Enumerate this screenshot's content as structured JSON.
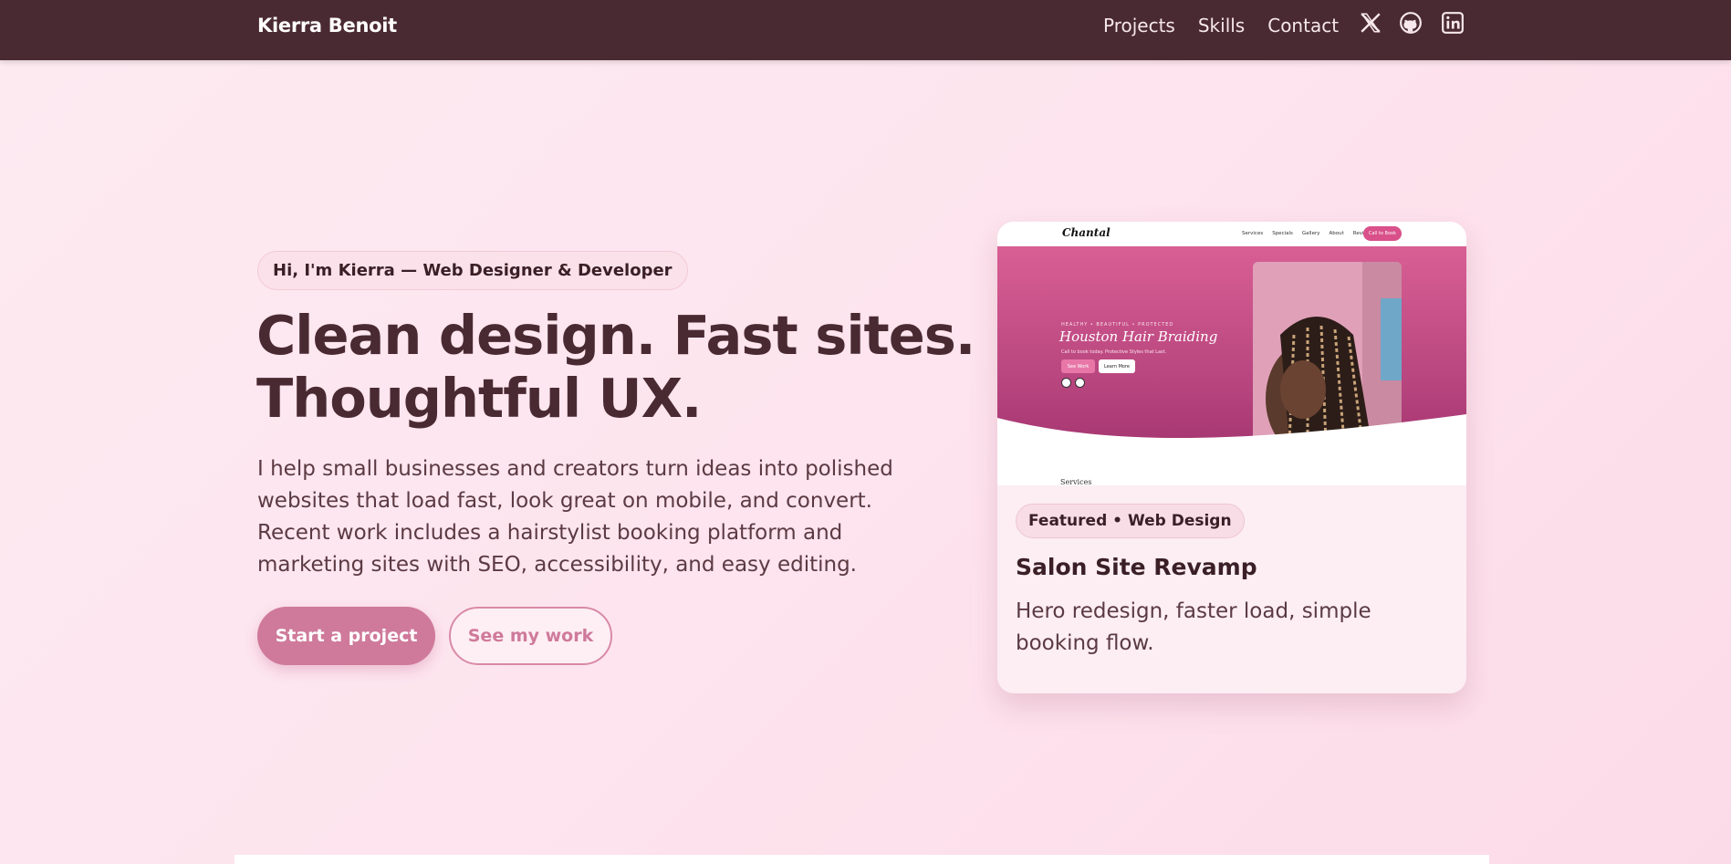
{
  "nav": {
    "brand": "Kierra Benoit",
    "links": [
      "Projects",
      "Skills",
      "Contact"
    ],
    "icons": [
      "x-twitter-icon",
      "github-icon",
      "linkedin-icon"
    ]
  },
  "hero": {
    "eyebrow": "Hi, I'm Kierra — Web Designer & Developer",
    "headline_line1": "Clean design. Fast sites.",
    "headline_line2": "Thoughtful UX.",
    "lede": "I help small businesses and creators turn ideas into polished websites that load fast, look great on mobile, and convert. Recent work includes a hairstylist booking platform and marketing sites with SEO, accessibility, and easy editing.",
    "primary_button": "Start a project",
    "secondary_button": "See my work"
  },
  "card": {
    "preview": {
      "logo": "Chantal",
      "links": [
        "Services",
        "Specials",
        "Gallery",
        "About",
        "Reviews"
      ],
      "cta": "Call to Book",
      "kicker": "HEALTHY • BEAUTIFUL • PROTECTED",
      "title": "Houston Hair Braiding",
      "subtitle": "Call to book today. Protective Styles that Last.",
      "button1": "See Work",
      "button2": "Learn More",
      "section_heading": "Services"
    },
    "tag": "Featured • Web Design",
    "title": "Salon Site Revamp",
    "description": "Hero redesign, faster load, simple booking flow."
  },
  "colors": {
    "nav_bg": "#4a2a32",
    "accent": "#cf7a9a",
    "text_dark": "#4a2a32"
  }
}
